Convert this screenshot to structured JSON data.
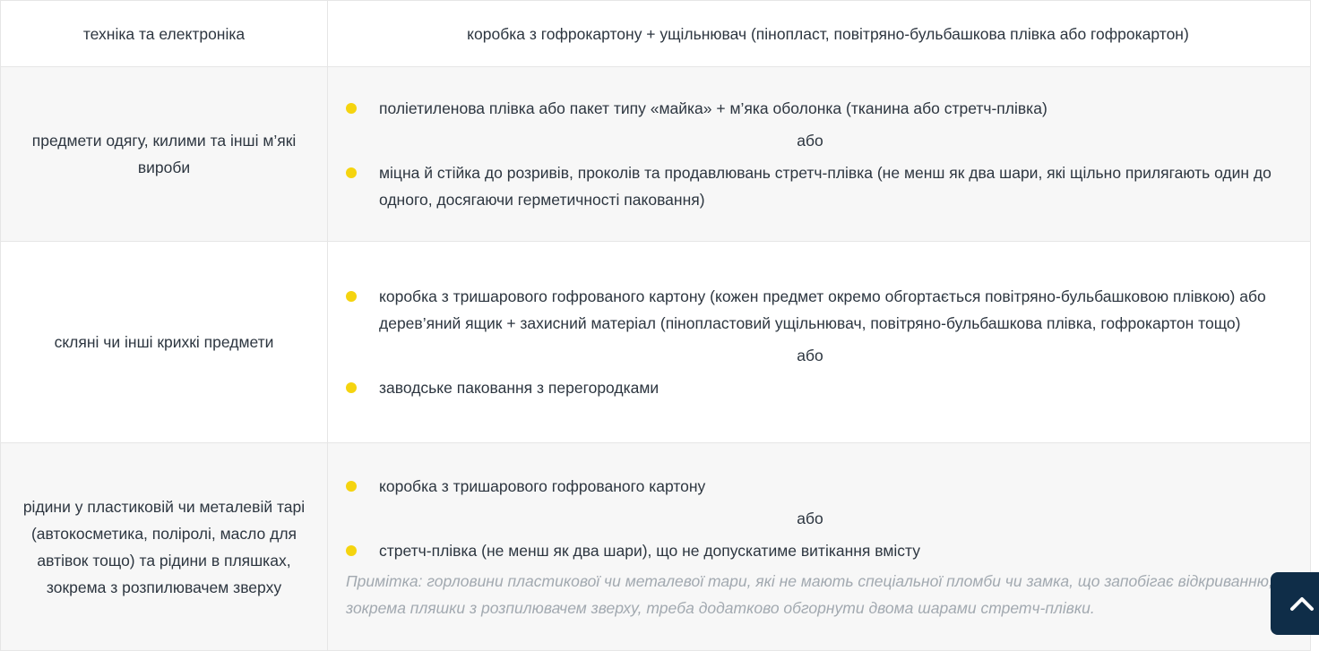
{
  "table": {
    "rows": [
      {
        "category": "техніка та електроніка",
        "packaging": "коробка з гофрокартону + ущільнювач (пінопласт, повітряно-бульбашкова плівка або гофрокартон)"
      },
      {
        "category": "предмети одягу, килими та інші м’які вироби",
        "option_1": "поліетиленова плівка або пакет типу «майка» + м’яка оболонка (тканина або стретч-плівка)",
        "or": "або",
        "option_2": "міцна й стійка до розривів, проколів та продавлювань стретч-плівка (не менш як два шари, які щільно прилягають один до одного, досягаючи герметичності паковання)"
      },
      {
        "category": "скляні чи інші крихкі предмети",
        "option_1": "коробка з тришарового гофрованого картону (кожен предмет окремо обгортається повітряно-бульбашковою плівкою) або дерев’яний ящик + захисний матеріал (пінопластовий ущільнювач, повітряно-бульбашкова плівка, гофрокартон тощо)",
        "or": "або",
        "option_2": "заводське паковання з перегородками"
      },
      {
        "category": "рідини у пластиковій чи металевій тарі (автокосметика, поліролі, масло для автівок тощо) та рідини в пляшках, зокрема з розпилювачем зверху",
        "option_1": "коробка з тришарового гофрованого картону",
        "or": "або",
        "option_2": "стретч-плівка (не менш як два шари), що не допускатиме витікання вмісту",
        "note": "Примітка: горловини пластикової чи металевої тари, які не мають спеціальної пломби чи замка, що запобігає відкриванню, зокрема пляшки з розпилювачем зверху, треба додатково обгорнути двома шарами стретч-плівки."
      }
    ]
  },
  "colors": {
    "bullet": "#f5d40f",
    "scroll_button": "#0f2d48",
    "row_alt": "#f7f7f7"
  },
  "icons": {
    "scroll_top": "chevron-up-icon"
  }
}
